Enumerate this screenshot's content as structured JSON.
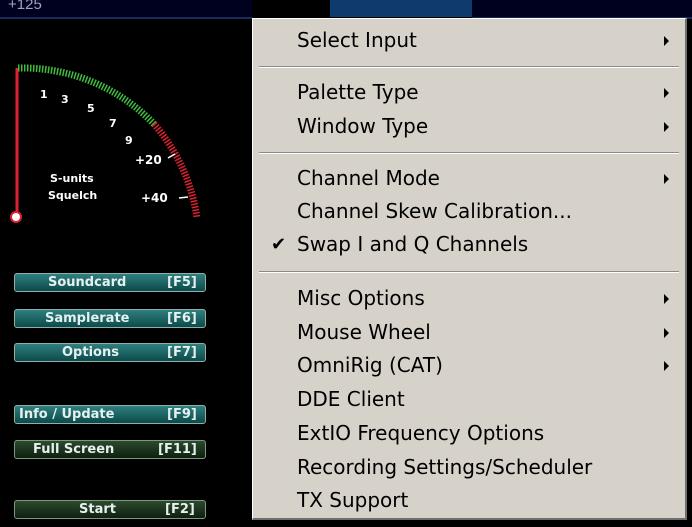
{
  "colors": {
    "menu_bg": "#d6d2ca",
    "panel_bg": "#000000",
    "button_teal": "#1f6a6a",
    "button_dark_green": "#1e3a22",
    "meter_green": "#3fbf3f",
    "meter_red": "#e02030"
  },
  "top_readout": "+125",
  "smeter": {
    "scale_labels": [
      "1",
      "3",
      "5",
      "7",
      "9",
      "+20",
      "+40"
    ],
    "label_units": "S-units",
    "label_squelch": "Squelch"
  },
  "buttons": [
    {
      "label": "Soundcard",
      "key": "[F5]",
      "style": "teal"
    },
    {
      "label": "Samplerate",
      "key": "[F6]",
      "style": "teal"
    },
    {
      "label": "Options",
      "key": "[F7]",
      "style": "teal"
    },
    {
      "label": "Info / Update",
      "key": "[F9]",
      "style": "teal"
    },
    {
      "label": "Full Screen",
      "key": "[F11]",
      "style": "dark"
    },
    {
      "label": "Start",
      "key": "[F2]",
      "style": "dark"
    }
  ],
  "menu": {
    "items": [
      {
        "label": "Select Input",
        "submenu": true,
        "checked": false
      },
      {
        "label": "Palette Type",
        "submenu": true,
        "checked": false
      },
      {
        "label": "Window Type",
        "submenu": true,
        "checked": false
      },
      {
        "label": "Channel Mode",
        "submenu": true,
        "checked": false
      },
      {
        "label": "Channel Skew Calibration...",
        "submenu": false,
        "checked": false
      },
      {
        "label": "Swap I and Q Channels",
        "submenu": false,
        "checked": true
      },
      {
        "label": "Misc Options",
        "submenu": true,
        "checked": false
      },
      {
        "label": "Mouse Wheel",
        "submenu": true,
        "checked": false
      },
      {
        "label": "OmniRig (CAT)",
        "submenu": true,
        "checked": false
      },
      {
        "label": "DDE Client",
        "submenu": false,
        "checked": false
      },
      {
        "label": "ExtIO Frequency Options",
        "submenu": false,
        "checked": false
      },
      {
        "label": "Recording Settings/Scheduler",
        "submenu": false,
        "checked": false
      },
      {
        "label": "TX Support",
        "submenu": false,
        "checked": false
      }
    ],
    "check_mark": "✔"
  }
}
